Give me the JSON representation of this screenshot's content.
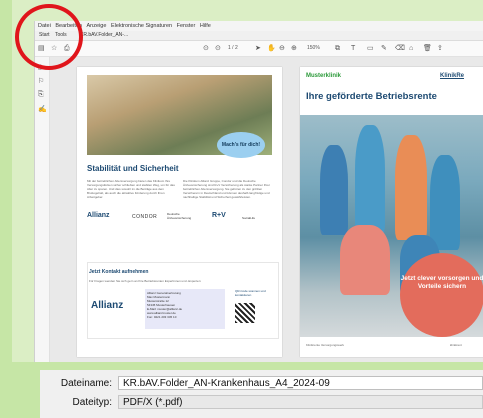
{
  "menu": {
    "items": [
      "Datei",
      "Bearbeiten",
      "Anzeige",
      "Elektronische Signaturen",
      "Fenster",
      "Hilfe"
    ]
  },
  "tabs": {
    "items": [
      "Start",
      "Tools",
      "KR.bAV.Folder_AN-..."
    ]
  },
  "toolbar": {
    "page_indicator": "1 / 2",
    "zoom": "150%"
  },
  "left_page": {
    "badge": "Mach's für dich!",
    "heading": "Stabilität und Sicherheit",
    "body1": "Mit der betrieblichen Altersversorgung bieten das Klinikum Ihre Versorgungslücken sicher schließen und stabilen Weg, um für das Alter zu sparen. Und dies sowohl im die Beiträge aus dem Bruttogehalt, als auch die attraktive Förderung durch Ihren Arbeitgeber.",
    "body2": "Die Klinikum Allianz Gruppe, Condor und die Deutsche Ärzteversicherung sind R+V Versicherung als starke Partner Ihrer betrieblichen Altersversorgung. Sie gehören zu den größten Versicherern in Deutschland und können deshalb langfristige und nachhaltige Stabilität und Sicherheit gewährleisten.",
    "logos": [
      "Allianz",
      "CONDOR",
      "Deutsche Ärzteversicherung",
      "R+V",
      "SocialLife"
    ],
    "contact_title": "Jetzt Kontakt aufnehmen",
    "contact_sub": "Für Fragen wenden Sie sich gern an Ihre Betriebsrenten Expertinnen und -Experten:",
    "allianz": "Allianz",
    "address_lines": [
      "Allianz Generalvertretung",
      "Max Mustermann",
      "Musterstraße 12",
      "54345 Musterhausen",
      "E-Mail: muster@allianz.de",
      "www.allianzmuster.de",
      "Fon: 0221 203 345 10"
    ],
    "qr_label": "QR-Code scannen und kontaktieren"
  },
  "right_page": {
    "logo": "Musterklinik",
    "logo_right": "KlinikRe",
    "title": "Ihre geförderte Betriebsrente",
    "cta": "Jetzt clever vorsorgen und Vorteile sichern",
    "footer_left": "Klinikrente Versorgungswerk",
    "footer_right": "klinikrent"
  },
  "save_dialog": {
    "filename_label": "Dateiname:",
    "filename_value": "KR.bAV.Folder_AN-Krankenhaus_A4_2024-09",
    "filetype_label": "Dateityp:",
    "filetype_value": "PDF/X (*.pdf)"
  },
  "colors": {
    "background": "#c6e6a6",
    "annotation": "#e0151b",
    "brand_blue": "#1d4a72",
    "cta": "#e36c5c"
  }
}
